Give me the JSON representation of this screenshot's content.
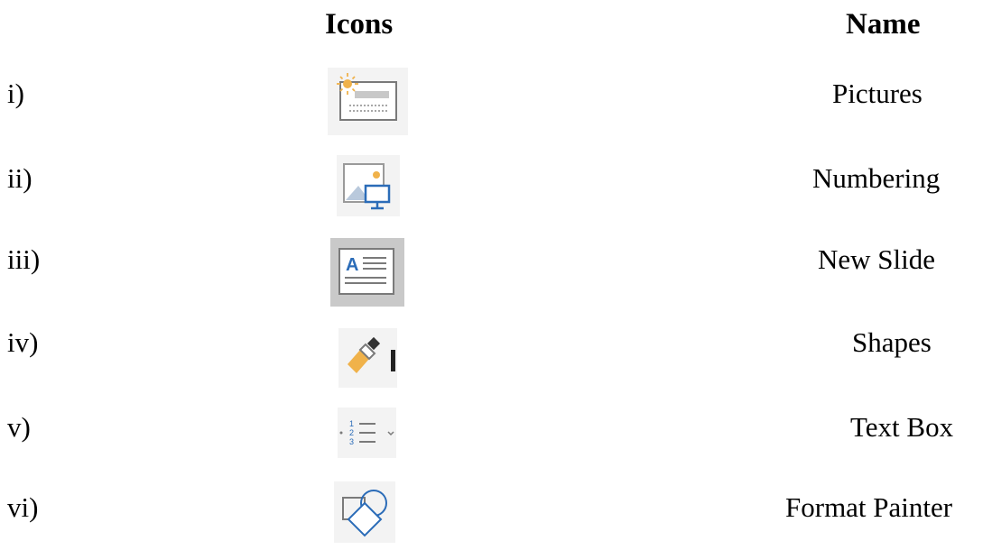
{
  "headers": {
    "icons": "Icons",
    "name": "Name"
  },
  "rows": [
    {
      "label": "i)",
      "icon": "title-slide-layout-icon",
      "name": "Pictures"
    },
    {
      "label": "ii)",
      "icon": "pictures-icon",
      "name": "Numbering"
    },
    {
      "label": "iii)",
      "icon": "text-box-icon",
      "name": "New Slide"
    },
    {
      "label": "iv)",
      "icon": "format-painter-icon",
      "name": "Shapes"
    },
    {
      "label": "v)",
      "icon": "numbering-icon",
      "name": "Text Box"
    },
    {
      "label": "vi)",
      "icon": "shapes-icon",
      "name": "Format Painter"
    }
  ],
  "colors": {
    "icon_background": "#f3f3f3",
    "icon_gray": "#7a7a7a",
    "icon_blue": "#2b6cb8",
    "icon_orange": "#f0b24a"
  }
}
